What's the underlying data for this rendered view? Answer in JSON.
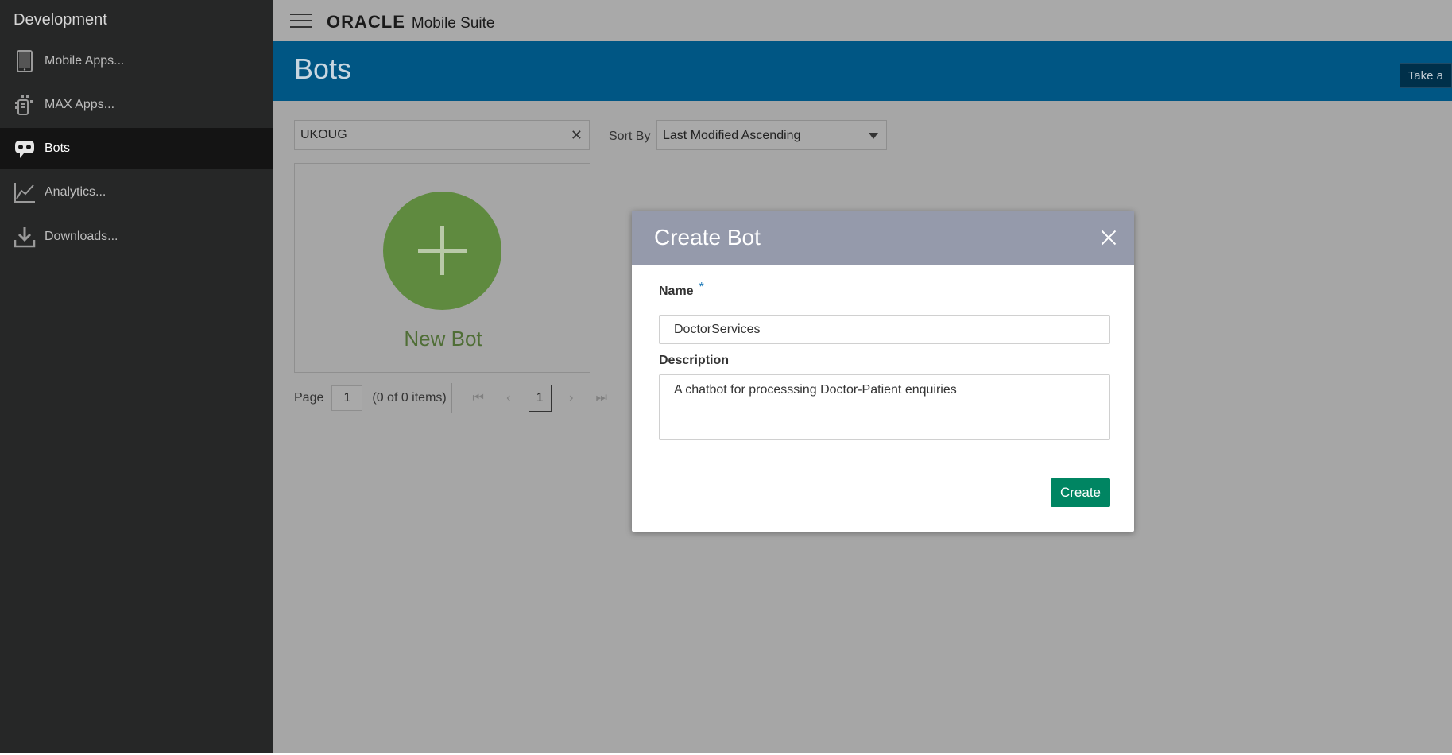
{
  "sidebar": {
    "title": "Development",
    "items": [
      {
        "label": "Mobile Apps...",
        "icon": "tablet-icon"
      },
      {
        "label": "MAX Apps...",
        "icon": "max-apps-icon"
      },
      {
        "label": "Bots",
        "icon": "bot-icon",
        "active": true
      },
      {
        "label": "Analytics...",
        "icon": "chart-line-icon"
      },
      {
        "label": "Downloads...",
        "icon": "download-icon"
      }
    ]
  },
  "topbar": {
    "brand": "ORACLE",
    "product": "Mobile Suite"
  },
  "header": {
    "title": "Bots",
    "tour_button": "Take a"
  },
  "toolbar": {
    "search_value": "UKOUG",
    "sort_label": "Sort By",
    "sort_value": "Last Modified Ascending"
  },
  "new_bot": {
    "label": "New Bot"
  },
  "pager": {
    "page_label": "Page",
    "page_value": "1",
    "count": "(0 of 0 items)",
    "current": "1",
    "first": "K",
    "prev": "<",
    "next": ">",
    "last": ">I"
  },
  "dialog": {
    "title": "Create Bot",
    "name_label": "Name",
    "required_mark": "*",
    "name_value": "DoctorServices",
    "description_label": "Description",
    "description_value": "A chatbot for processsing Doctor-Patient enquiries",
    "create_button": "Create"
  },
  "colors": {
    "sidebar_bg": "#262727",
    "brand_blue": "#005684",
    "new_bot_green": "#5f8a3f",
    "create_green": "#008562",
    "dialog_header": "#959aab"
  }
}
